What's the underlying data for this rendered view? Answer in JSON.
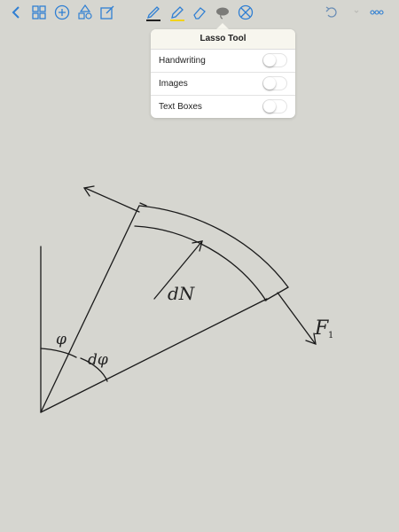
{
  "toolbar": {
    "left_icons": [
      "back-chevron-icon",
      "thumbnails-icon",
      "add-icon",
      "shapes-icon",
      "edit-icon"
    ],
    "center_icons": [
      "pen-icon",
      "highlighter-icon",
      "eraser-icon",
      "lasso-icon",
      "no-touch-icon"
    ],
    "right_icons": [
      "undo-icon",
      "redo-icon",
      "more-icon"
    ],
    "pen_color": "#222222",
    "highlighter_color": "#f2d21a",
    "accent": "#2f7fd3"
  },
  "lasso_popover": {
    "title": "Lasso Tool",
    "options": [
      {
        "label": "Handwriting",
        "enabled": false
      },
      {
        "label": "Images",
        "enabled": false
      },
      {
        "label": "Text Boxes",
        "enabled": false
      }
    ]
  },
  "drawing": {
    "label_phi": "φ",
    "label_dphi": "dφ",
    "label_dN": "dN",
    "label_F": "F",
    "label_F_sub": "1"
  }
}
